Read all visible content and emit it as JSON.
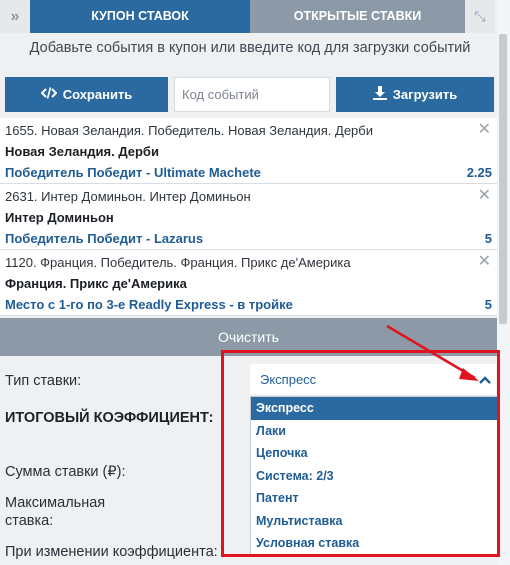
{
  "tabs": {
    "coupon_label": "КУПОН СТАВОК",
    "open_label": "ОТКРЫТЫЕ СТАВКИ",
    "expand_glyph": "»",
    "shrink_glyph": "⤡"
  },
  "hint": "Добавьте события в купон или введите код для загрузки событий",
  "toolbar": {
    "save_label": "Сохранить",
    "code_placeholder": "Код событий",
    "load_label": "Загрузить"
  },
  "bets": [
    {
      "header": "1655. Новая Зеландия. Победитель. Новая Зеландия. Дерби",
      "event": "Новая Зеландия. Дерби",
      "selection": "Победитель Победит - Ultimate Machete",
      "odds": "2.25"
    },
    {
      "header": "2631. Интер Доминьон. Интер Доминьон",
      "event": "Интер Доминьон",
      "selection": "Победитель Победит - Lazarus",
      "odds": "5"
    },
    {
      "header": "1120. Франция. Победитель. Франция. Прикс де'Америка",
      "event": "Франция. Прикс де'Америка",
      "selection": "Место с 1-го по 3-е Readly Express - в тройке",
      "odds": "5"
    }
  ],
  "clear_label": "Очистить",
  "form": {
    "bet_type_label": "Тип ставки:",
    "bet_type_value": "Экспресс",
    "total_coef_label": "ИТОГОВЫЙ КОЭФФИЦИЕНТ:",
    "stake_label": "Сумма ставки (₽):",
    "max_stake_label_line1": "Максимальная",
    "max_stake_label_line2": "ставка:",
    "on_change_label": "При изменении коэффициента:"
  },
  "dropdown_options": [
    "Экспресс",
    "Лаки",
    "Цепочка",
    "Система: 2/3",
    "Патент",
    "Мультиставка",
    "Условная ставка"
  ],
  "colors": {
    "primary": "#2b6aa0",
    "secondary": "#8c9aa8",
    "annotation": "#e0141e",
    "link": "#1f5c94"
  }
}
